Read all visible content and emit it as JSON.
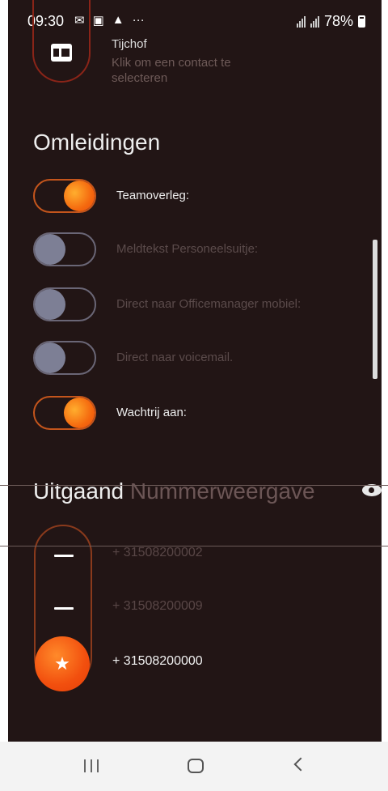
{
  "status_bar": {
    "time": "09:30",
    "notification_icons": [
      "message-icon",
      "image-icon",
      "warning-icon",
      "more-icon"
    ],
    "battery_percent": "78%"
  },
  "contact": {
    "name": "Tijchof",
    "hint": "Klik om een contact te selecteren"
  },
  "diversions": {
    "heading": "Omleidingen",
    "items": [
      {
        "label": "Teamoverleg:",
        "enabled": true
      },
      {
        "label": "Meldtekst Personeelsuitje:",
        "enabled": false
      },
      {
        "label": "Direct naar Officemanager mobiel:",
        "enabled": false
      },
      {
        "label": "Direct naar voicemail.",
        "enabled": false
      },
      {
        "label": "Wachtrij aan:",
        "enabled": true
      }
    ]
  },
  "outgoing": {
    "heading_part1": "Uitgaand",
    "heading_part2": "Nummerweergave",
    "numbers": [
      {
        "label": "+ 31508200002",
        "selected": false
      },
      {
        "label": "+ 31508200009",
        "selected": false
      },
      {
        "label": "+ 31508200000",
        "selected": true
      }
    ],
    "selected_icon": "★"
  },
  "colors": {
    "background": "#221515",
    "accent": "#f56a0f",
    "off_knob": "#7d7f95"
  }
}
